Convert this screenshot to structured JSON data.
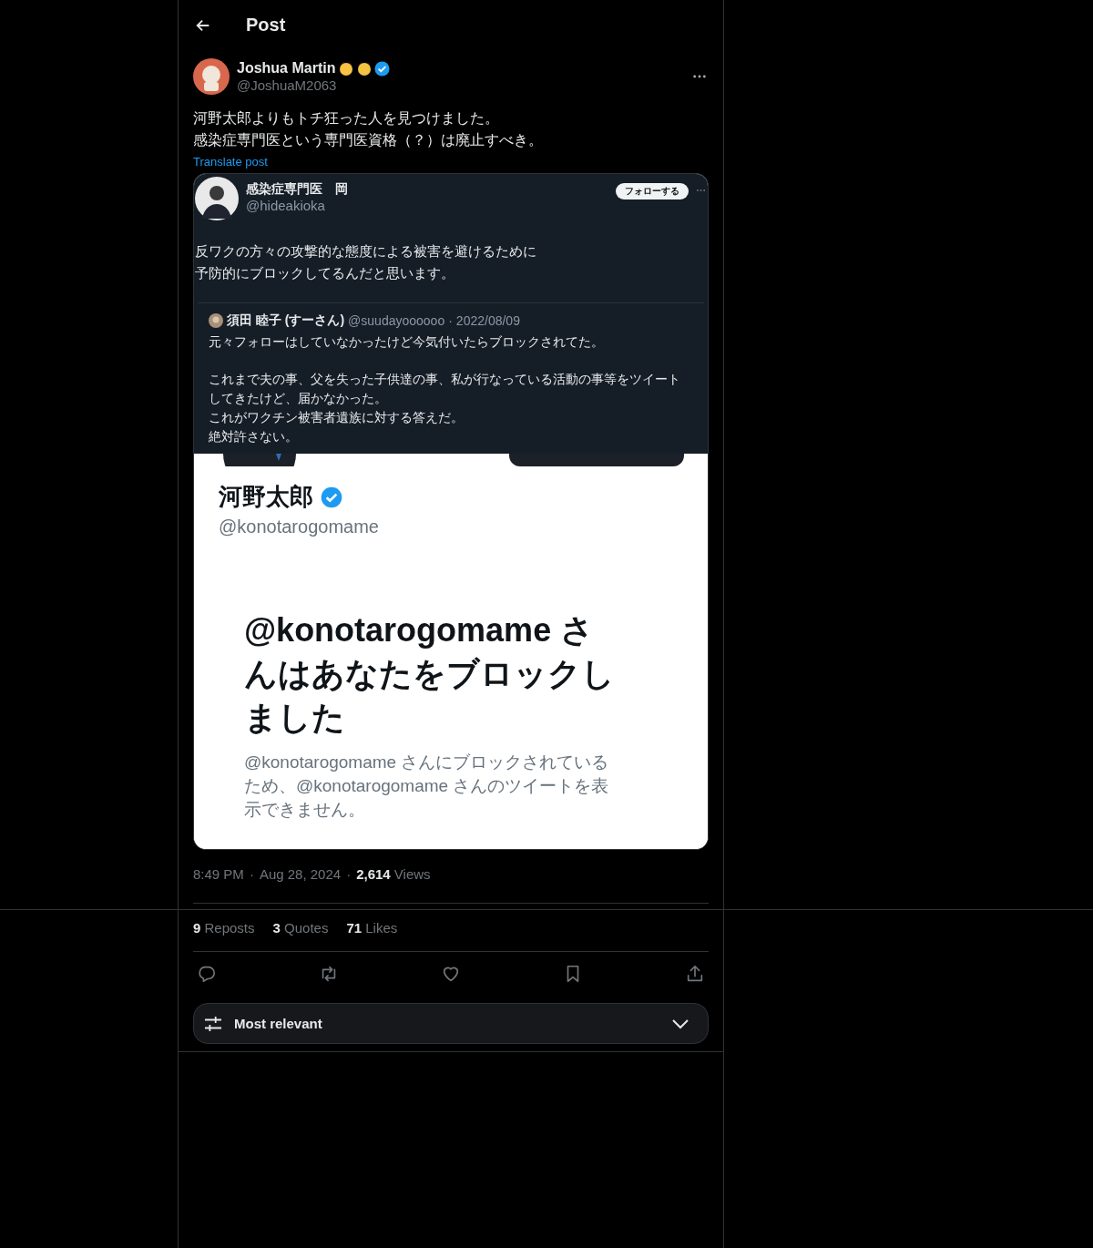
{
  "header": {
    "title": "Post"
  },
  "post": {
    "author": {
      "name": "Joshua Martin",
      "verified": true,
      "handle": "@JoshuaM2063"
    },
    "text_lines": [
      "河野太郎よりもトチ狂った人を見つけました。",
      "感染症専門医という専門医資格（？）は廃止すべき。"
    ],
    "translate": "Translate post",
    "screenshot": {
      "tweet": {
        "name": "感染症専門医　岡",
        "handle": "@hideakioka",
        "follow_button": "フォローする",
        "text_lines": [
          "反ワクの方々の攻撃的な態度による被害を避けるために",
          "予防的にブロックしてるんだと思います。"
        ]
      },
      "quoted": {
        "name": "須田 睦子 (すーさん)",
        "handle": "@suudayoooooo",
        "separator": "·",
        "date": "2022/08/09",
        "paragraphs": [
          [
            "元々フォローはしていなかったけど今気付いたらブロックされてた。"
          ],
          [
            "これまで夫の事、父を失った子供達の事、私が行なっている活動の事等をツイート",
            "してきたけど、届かなかった。",
            "これがワクチン被害者遺族に対する答えだ。",
            "絶対許さない。"
          ]
        ]
      },
      "profile": {
        "name": "河野太郎",
        "verified": true,
        "handle": "@konotarogomame"
      },
      "notice": {
        "heading_lines": [
          "@konotarogomame さ",
          "んはあなたをブロックし",
          "ました"
        ],
        "body_lines": [
          "@konotarogomame さんにブロックされている",
          "ため、@konotarogomame さんのツイートを表",
          "示できません。"
        ]
      }
    },
    "meta": {
      "time": "8:49 PM",
      "separators": [
        "·",
        "·"
      ],
      "date": "Aug 28, 2024",
      "views_count": "2,614",
      "views_label": "Views"
    },
    "stats": [
      {
        "count": "9",
        "label": "Reposts"
      },
      {
        "count": "3",
        "label": "Quotes"
      },
      {
        "count": "71",
        "label": "Likes"
      }
    ],
    "actions": [
      {
        "kind": "reply"
      },
      {
        "kind": "repost"
      },
      {
        "kind": "like"
      },
      {
        "kind": "bookmark"
      },
      {
        "kind": "share"
      }
    ]
  },
  "sort": {
    "label": "Most relevant"
  }
}
